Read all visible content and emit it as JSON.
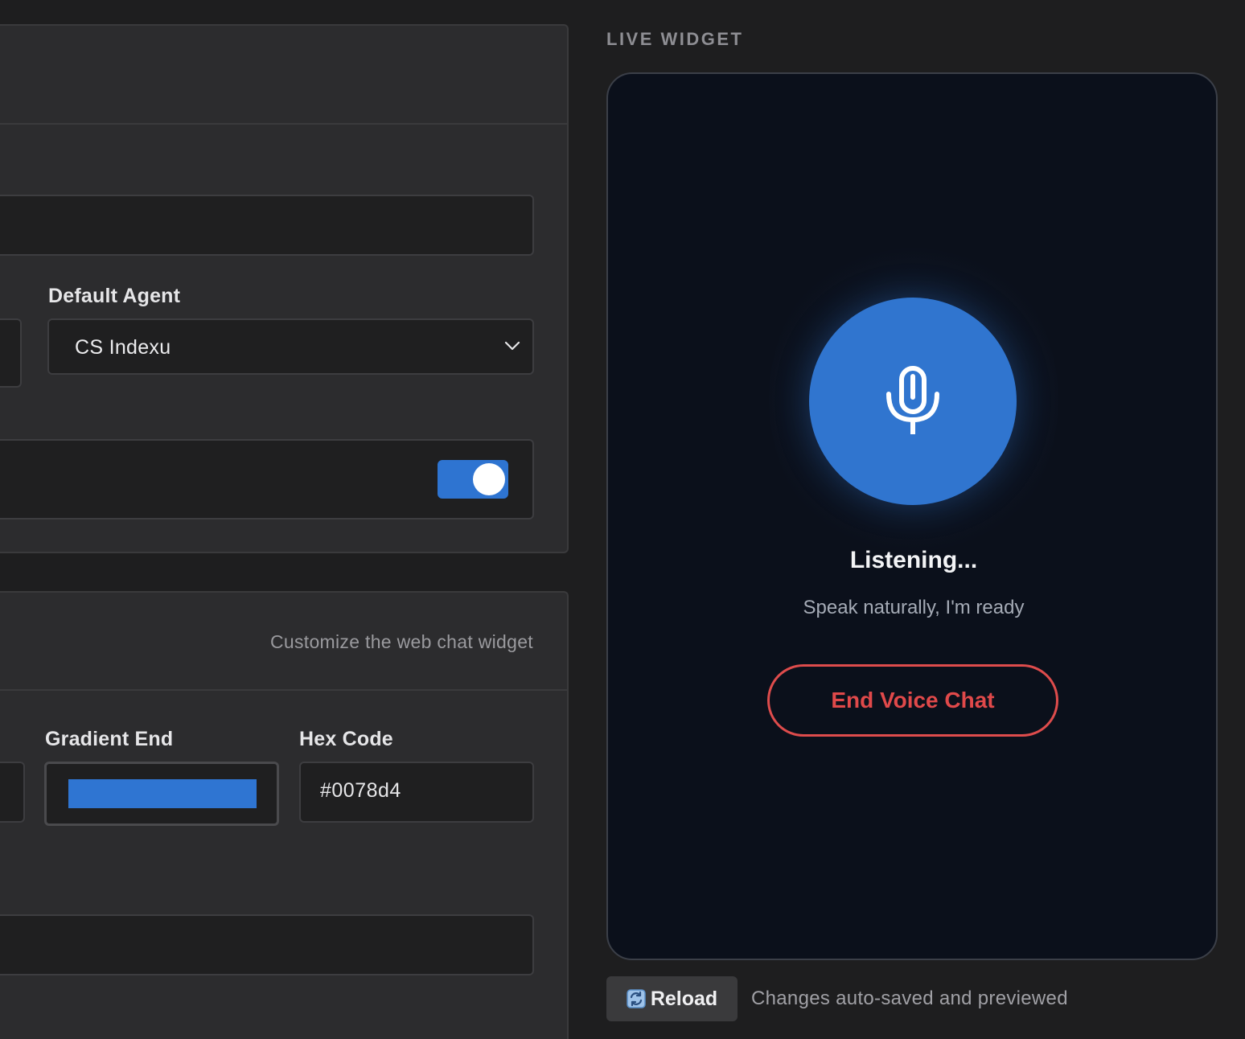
{
  "settings": {
    "default_agent": {
      "label": "Default Agent",
      "selected": "CS Indexu"
    },
    "toggle": {
      "state": "on"
    }
  },
  "widget_settings": {
    "subtitle": "Customize the web chat widget",
    "gradient_end": {
      "label": "Gradient End",
      "color": "#2f75d2"
    },
    "hex_code": {
      "label": "Hex Code",
      "value": "#0078d4"
    }
  },
  "live_widget": {
    "title": "LIVE WIDGET",
    "status_title": "Listening...",
    "status_subtitle": "Speak naturally, I'm ready",
    "end_button": "End Voice Chat",
    "icon": "microphone-icon",
    "accent_color": "#3075cf",
    "danger_color": "#e0494a"
  },
  "footer": {
    "reload_label": "Reload",
    "reload_icon": "refresh-icon",
    "autosave_text": "Changes auto-saved and previewed"
  }
}
